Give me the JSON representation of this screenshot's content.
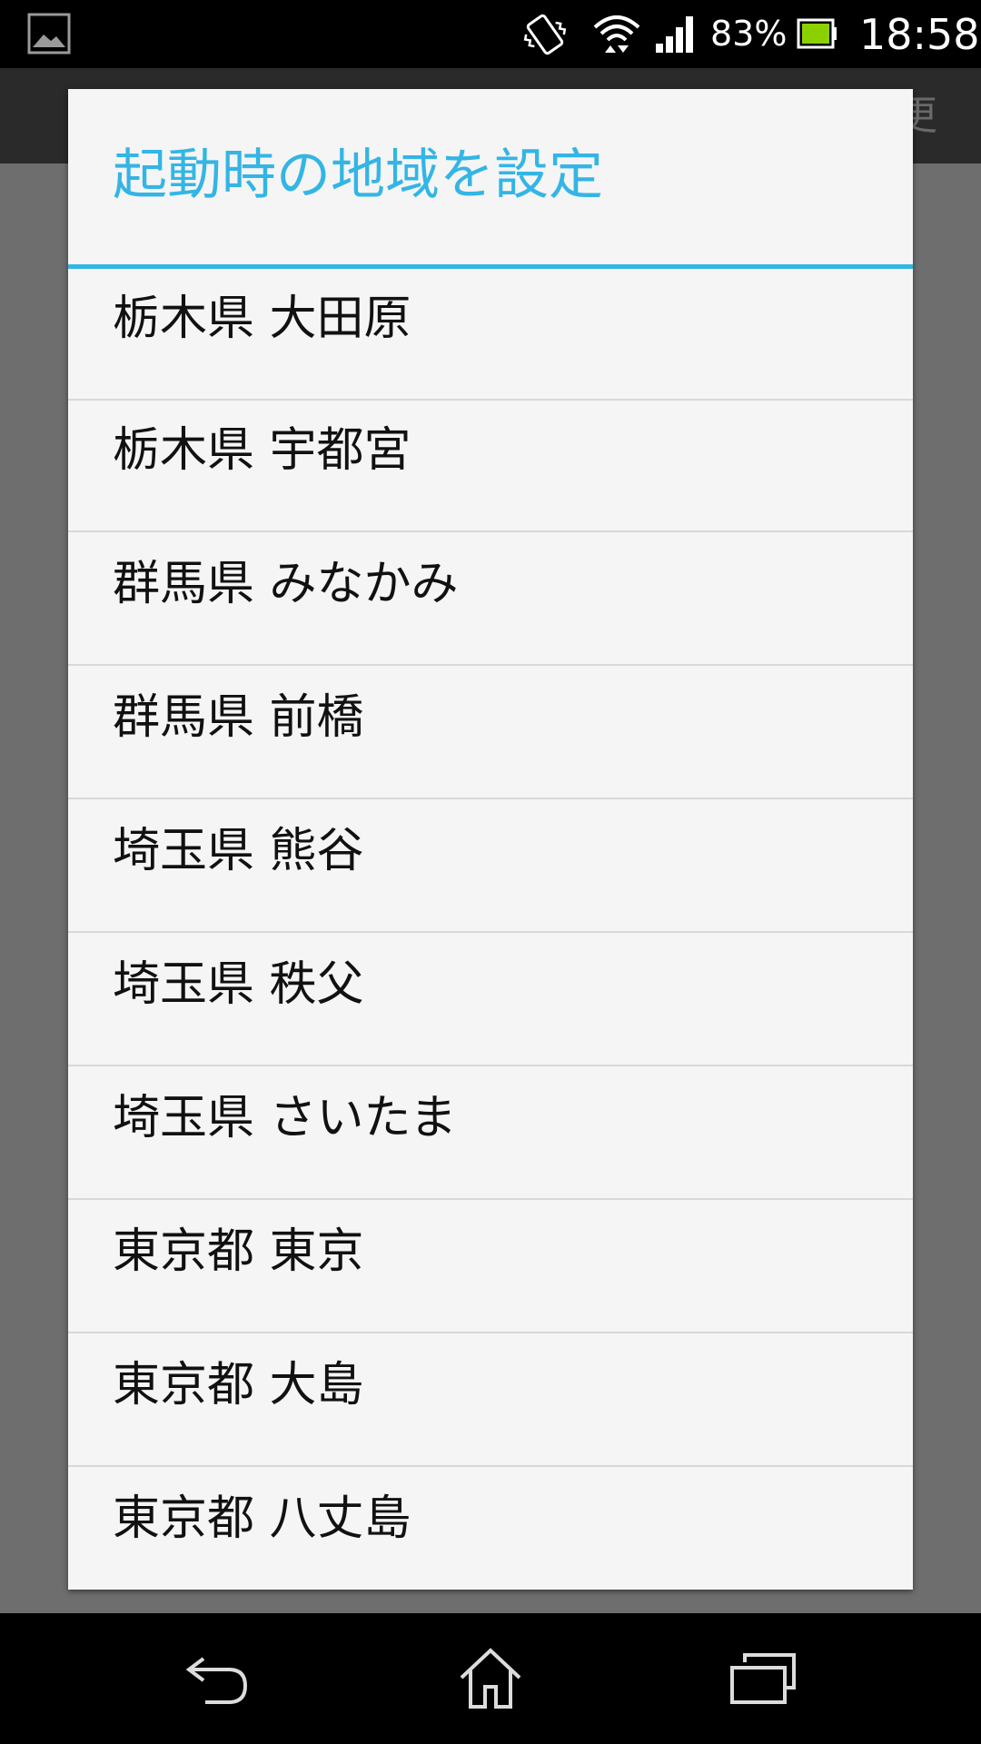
{
  "status_bar": {
    "battery_percent": "83%",
    "time": "18:58",
    "icons": [
      "gallery-icon",
      "vibrate-icon",
      "wifi-icon",
      "signal-icon",
      "battery-icon"
    ]
  },
  "background": {
    "action_bar_partial_text": "更"
  },
  "dialog": {
    "title": "起動時の地域を設定",
    "accent_color": "#33b5e5",
    "items": [
      {
        "label": "栃木県 大田原"
      },
      {
        "label": "栃木県 宇都宮"
      },
      {
        "label": "群馬県 みなかみ"
      },
      {
        "label": "群馬県 前橋"
      },
      {
        "label": "埼玉県 熊谷"
      },
      {
        "label": "埼玉県 秩父"
      },
      {
        "label": "埼玉県 さいたま"
      },
      {
        "label": "東京都 東京"
      },
      {
        "label": "東京都 大島"
      },
      {
        "label": "東京都 八丈島"
      }
    ]
  },
  "nav_bar": {
    "icons": [
      "back-icon",
      "home-icon",
      "recent-apps-icon"
    ]
  }
}
